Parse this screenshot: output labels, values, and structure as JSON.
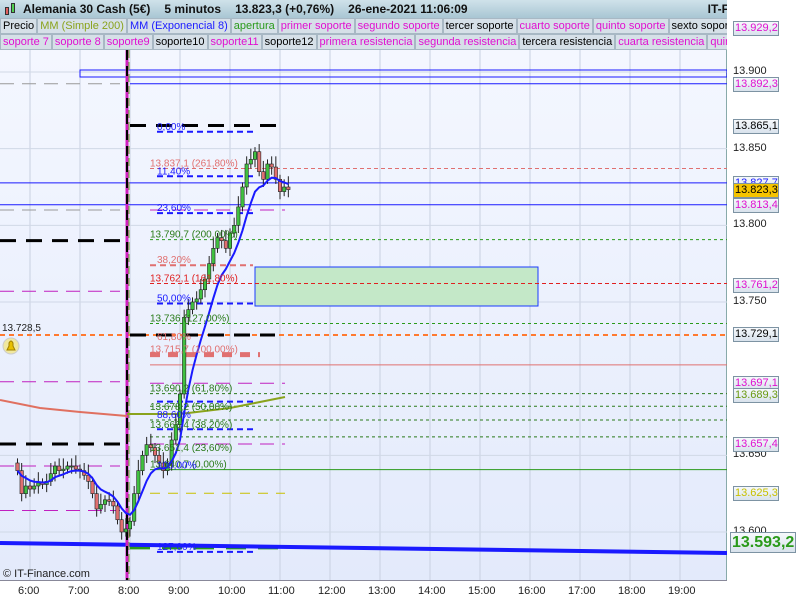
{
  "title": {
    "instrument": "Alemania 30 Cash (5€)",
    "timeframe": "5 minutos",
    "price": "13.823,3 (+0,76%)",
    "datetime": "26-ene-2021 11:06:09",
    "brand": "IT-Finance.com"
  },
  "legend_row1": [
    {
      "label": "Precio",
      "color": "#000000"
    },
    {
      "label": "MM (Simple 200)",
      "color": "#8aa31c"
    },
    {
      "label": "MM (Exponencial 8)",
      "color": "#1a1aff"
    },
    {
      "label": "apertura",
      "color": "#2a9a1a"
    },
    {
      "label": "primer soporte",
      "color": "#e010d0"
    },
    {
      "label": "segundo soporte",
      "color": "#e010d0"
    },
    {
      "label": "tercer soporte",
      "color": "#000000"
    },
    {
      "label": "cuarto soporte",
      "color": "#e010d0"
    },
    {
      "label": "quinto soporte",
      "color": "#e010d0"
    },
    {
      "label": "sexto soporte",
      "color": "#000000"
    }
  ],
  "legend_row2": [
    {
      "label": "soporte 7",
      "color": "#e010d0"
    },
    {
      "label": "soporte 8",
      "color": "#e010d0"
    },
    {
      "label": "soporte9",
      "color": "#e010d0"
    },
    {
      "label": "soporte10",
      "color": "#000000"
    },
    {
      "label": "soporte11",
      "color": "#e010d0"
    },
    {
      "label": "soporte12",
      "color": "#000000"
    },
    {
      "label": "primera resistencia",
      "color": "#e010d0"
    },
    {
      "label": "segunda resistencia",
      "color": "#e010d0"
    },
    {
      "label": "tercera resistencia",
      "color": "#000000"
    },
    {
      "label": "cuarta resistencia",
      "color": "#e010d0"
    },
    {
      "label": "quinta",
      "color": "#e010d0"
    }
  ],
  "chart_data": {
    "type": "candlestick",
    "y_ticks": [
      "13.900",
      "13.850",
      "13.800",
      "13.750",
      "13.650",
      "13.600"
    ],
    "y_tick_values": [
      13900,
      13850,
      13800,
      13750,
      13650,
      13600
    ],
    "x_ticks": [
      "6:00",
      "7:00",
      "8:00",
      "9:00",
      "10:00",
      "11:00",
      "12:00",
      "13:00",
      "14:00",
      "15:00",
      "16:00",
      "17:00",
      "18:00",
      "19:00"
    ],
    "candle_start_minutes_from_6": -15,
    "candle_interval_minutes": 5,
    "closes": [
      13640,
      13625,
      13630,
      13628,
      13630,
      13632,
      13631,
      13633,
      13638,
      13643,
      13640,
      13641,
      13643,
      13643,
      13641,
      13640,
      13637,
      13633,
      13625,
      13615,
      13618,
      13621,
      13620,
      13617,
      13608,
      13600,
      13602,
      13607,
      13625,
      13640,
      13650,
      13657,
      13655,
      13650,
      13645,
      13640,
      13645,
      13660,
      13670,
      13690,
      13740,
      13745,
      13750,
      13752,
      13758,
      13765,
      13775,
      13785,
      13792,
      13790,
      13785,
      13795,
      13800,
      13812,
      13825,
      13840,
      13843,
      13848,
      13835,
      13830,
      13840,
      13838,
      13830,
      13822,
      13825,
      13823.3
    ],
    "price_labels": [
      {
        "text": "13.929,2",
        "price": 13929.2,
        "color": "#e010d0"
      },
      {
        "text": "13.892,3",
        "price": 13892.3,
        "color": "#e010d0"
      },
      {
        "text": "13.865,1",
        "price": 13865.1,
        "color": "#000000"
      },
      {
        "text": "13.827,7",
        "price": 13827.7,
        "color": "#1a1aff"
      },
      {
        "text": "13.823,3",
        "price": 13823.3,
        "color": "#000000",
        "highlight": "#f5c400"
      },
      {
        "text": "13.813,4",
        "price": 13813.4,
        "color": "#e010d0"
      },
      {
        "text": "13.761,2",
        "price": 13761.2,
        "color": "#e010d0"
      },
      {
        "text": "13.729,1",
        "price": 13729.1,
        "color": "#000000"
      },
      {
        "text": "13.697,1",
        "price": 13697.1,
        "color": "#e010d0"
      },
      {
        "text": "13.689,3",
        "price": 13689.3,
        "color": "#6a9a10"
      },
      {
        "text": "13.657,4",
        "price": 13657.4,
        "color": "#e010d0"
      },
      {
        "text": "13.625,3",
        "price": 13625.3,
        "color": "#c8c000"
      },
      {
        "text": "13.593,2",
        "price": 13593.2,
        "color": "#2a9a1a",
        "large": true
      }
    ],
    "fib_labels": [
      {
        "text": "0,00%",
        "price": 13861,
        "color": "#1a1aff"
      },
      {
        "text": "13.837,1 (261,80%)",
        "price": 13837.1,
        "color": "#e07070"
      },
      {
        "text": "11,40%",
        "price": 13832,
        "color": "#1a1aff"
      },
      {
        "text": "23,60%",
        "price": 13808,
        "color": "#1a1aff"
      },
      {
        "text": "13.790,7 (200,00%)",
        "price": 13790.7,
        "color": "#2a7a1a"
      },
      {
        "text": "38,20%",
        "price": 13774,
        "color": "#e07070"
      },
      {
        "text": "13.762,1 (161,80%)",
        "price": 13762.1,
        "color": "#e02020"
      },
      {
        "text": "50,00%",
        "price": 13749,
        "color": "#1a1aff"
      },
      {
        "text": "13.736 (127,00%)",
        "price": 13736,
        "color": "#2a7a1a"
      },
      {
        "text": "61,80%",
        "price": 13724,
        "color": "#e07070"
      },
      {
        "text": "13.715,7 (100,00%)",
        "price": 13715.7,
        "color": "#e07070"
      },
      {
        "text": "13.690,2 (61,80%)",
        "price": 13690.2,
        "color": "#2a7a1a"
      },
      {
        "text": "13.678,2 (50,00%)",
        "price": 13678.2,
        "color": "#2a7a1a"
      },
      {
        "text": "13.666,4 (38,20%)",
        "price": 13666.4,
        "color": "#2a7a1a"
      },
      {
        "text": "88,60%",
        "price": 13673,
        "color": "#1a1aff"
      },
      {
        "text": "13.651,4 (23,60%)",
        "price": 13651.4,
        "color": "#2a7a1a"
      },
      {
        "text": "13.640,7 (0,00%)",
        "price": 13640.7,
        "color": "#2a7a1a"
      },
      {
        "text": "100,00%",
        "price": 13640,
        "color": "#1a1aff"
      },
      {
        "text": "127,00%",
        "price": 13587,
        "color": "#1a1aff"
      }
    ],
    "alert_label": "13.728,5",
    "watermark": "© IT-Finance.com"
  }
}
